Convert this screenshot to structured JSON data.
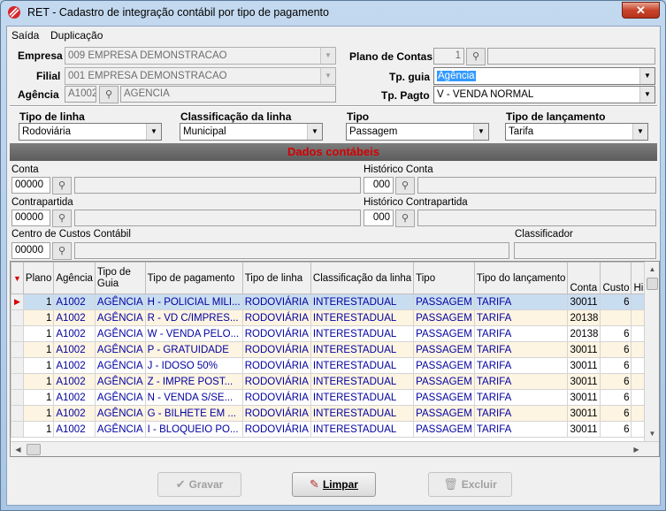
{
  "window": {
    "title": "RET - Cadastro de integração contábil por tipo de pagamento",
    "close_label": "✕"
  },
  "menu": [
    "Saída",
    "Duplicação"
  ],
  "header": {
    "empresa": {
      "label": "Empresa",
      "value": "009 EMPRESA DEMONSTRACAO"
    },
    "filial": {
      "label": "Filial",
      "value": "001 EMPRESA DEMONSTRACAO"
    },
    "agencia": {
      "label": "Agência",
      "code": "A1002",
      "name": "AGENCIA"
    },
    "plano_contas": {
      "label": "Plano de Contas",
      "value": "1"
    },
    "tp_guia": {
      "label": "Tp. guia",
      "value": "Agência"
    },
    "tp_pagto": {
      "label": "Tp. Pagto",
      "value": "V - VENDA NORMAL"
    }
  },
  "filters": {
    "tipo_linha": {
      "label": "Tipo de  linha",
      "value": "Rodoviária"
    },
    "classificacao": {
      "label": "Classificação da linha",
      "value": "Municipal"
    },
    "tipo": {
      "label": "Tipo",
      "value": "Passagem"
    },
    "tipo_lancamento": {
      "label": "Tipo de lançamento",
      "value": "Tarifa"
    }
  },
  "dados_contabeis": {
    "title": "Dados contábeis",
    "conta": {
      "label": "Conta",
      "value": "00000"
    },
    "historico_conta": {
      "label": "Histórico Conta",
      "value": "000"
    },
    "contrapartida": {
      "label": "Contrapartida",
      "value": "00000"
    },
    "historico_contrapartida": {
      "label": "Histórico Contrapartida",
      "value": "000"
    },
    "centro_custos": {
      "label": "Centro de Custos Contábil",
      "value": "00000"
    },
    "classificador": {
      "label": "Classificador",
      "value": ""
    }
  },
  "grid": {
    "columns": [
      "Plano",
      "Agência",
      "Tipo de Guia",
      "Tipo de pagamento",
      "Tipo de linha",
      "Classificação da linha",
      "Tipo",
      "Tipo do lançamento",
      "Conta",
      "Custo",
      "Histo"
    ],
    "rows": [
      {
        "plano": "1",
        "agencia": "A1002",
        "guia": "AGÊNCIA",
        "pagamento": "H - POLICIAL MILI...",
        "linha": "RODOVIÁRIA",
        "classif": "INTERESTADUAL",
        "tipo": "PASSAGEM",
        "lanc": "TARIFA",
        "conta": "30011",
        "custo": "6"
      },
      {
        "plano": "1",
        "agencia": "A1002",
        "guia": "AGÊNCIA",
        "pagamento": "R - VD C/IMPRES...",
        "linha": "RODOVIÁRIA",
        "classif": "INTERESTADUAL",
        "tipo": "PASSAGEM",
        "lanc": "TARIFA",
        "conta": "20138",
        "custo": ""
      },
      {
        "plano": "1",
        "agencia": "A1002",
        "guia": "AGÊNCIA",
        "pagamento": "W - VENDA PELO...",
        "linha": "RODOVIÁRIA",
        "classif": "INTERESTADUAL",
        "tipo": "PASSAGEM",
        "lanc": "TARIFA",
        "conta": "20138",
        "custo": "6"
      },
      {
        "plano": "1",
        "agencia": "A1002",
        "guia": "AGÊNCIA",
        "pagamento": "P - GRATUIDADE",
        "linha": "RODOVIÁRIA",
        "classif": "INTERESTADUAL",
        "tipo": "PASSAGEM",
        "lanc": "TARIFA",
        "conta": "30011",
        "custo": "6"
      },
      {
        "plano": "1",
        "agencia": "A1002",
        "guia": "AGÊNCIA",
        "pagamento": "J - IDOSO 50%",
        "linha": "RODOVIÁRIA",
        "classif": "INTERESTADUAL",
        "tipo": "PASSAGEM",
        "lanc": "TARIFA",
        "conta": "30011",
        "custo": "6"
      },
      {
        "plano": "1",
        "agencia": "A1002",
        "guia": "AGÊNCIA",
        "pagamento": "Z - IMPRE POST...",
        "linha": "RODOVIÁRIA",
        "classif": "INTERESTADUAL",
        "tipo": "PASSAGEM",
        "lanc": "TARIFA",
        "conta": "30011",
        "custo": "6"
      },
      {
        "plano": "1",
        "agencia": "A1002",
        "guia": "AGÊNCIA",
        "pagamento": "N - VENDA S/SE...",
        "linha": "RODOVIÁRIA",
        "classif": "INTERESTADUAL",
        "tipo": "PASSAGEM",
        "lanc": "TARIFA",
        "conta": "30011",
        "custo": "6"
      },
      {
        "plano": "1",
        "agencia": "A1002",
        "guia": "AGÊNCIA",
        "pagamento": "G - BILHETE EM ...",
        "linha": "RODOVIÁRIA",
        "classif": "INTERESTADUAL",
        "tipo": "PASSAGEM",
        "lanc": "TARIFA",
        "conta": "30011",
        "custo": "6"
      },
      {
        "plano": "1",
        "agencia": "A1002",
        "guia": "AGÊNCIA",
        "pagamento": "I - BLOQUEIO PO...",
        "linha": "RODOVIÁRIA",
        "classif": "INTERESTADUAL",
        "tipo": "PASSAGEM",
        "lanc": "TARIFA",
        "conta": "30011",
        "custo": "6"
      }
    ]
  },
  "buttons": {
    "gravar": "Gravar",
    "limpar": "Limpar",
    "excluir": "Excluir"
  }
}
